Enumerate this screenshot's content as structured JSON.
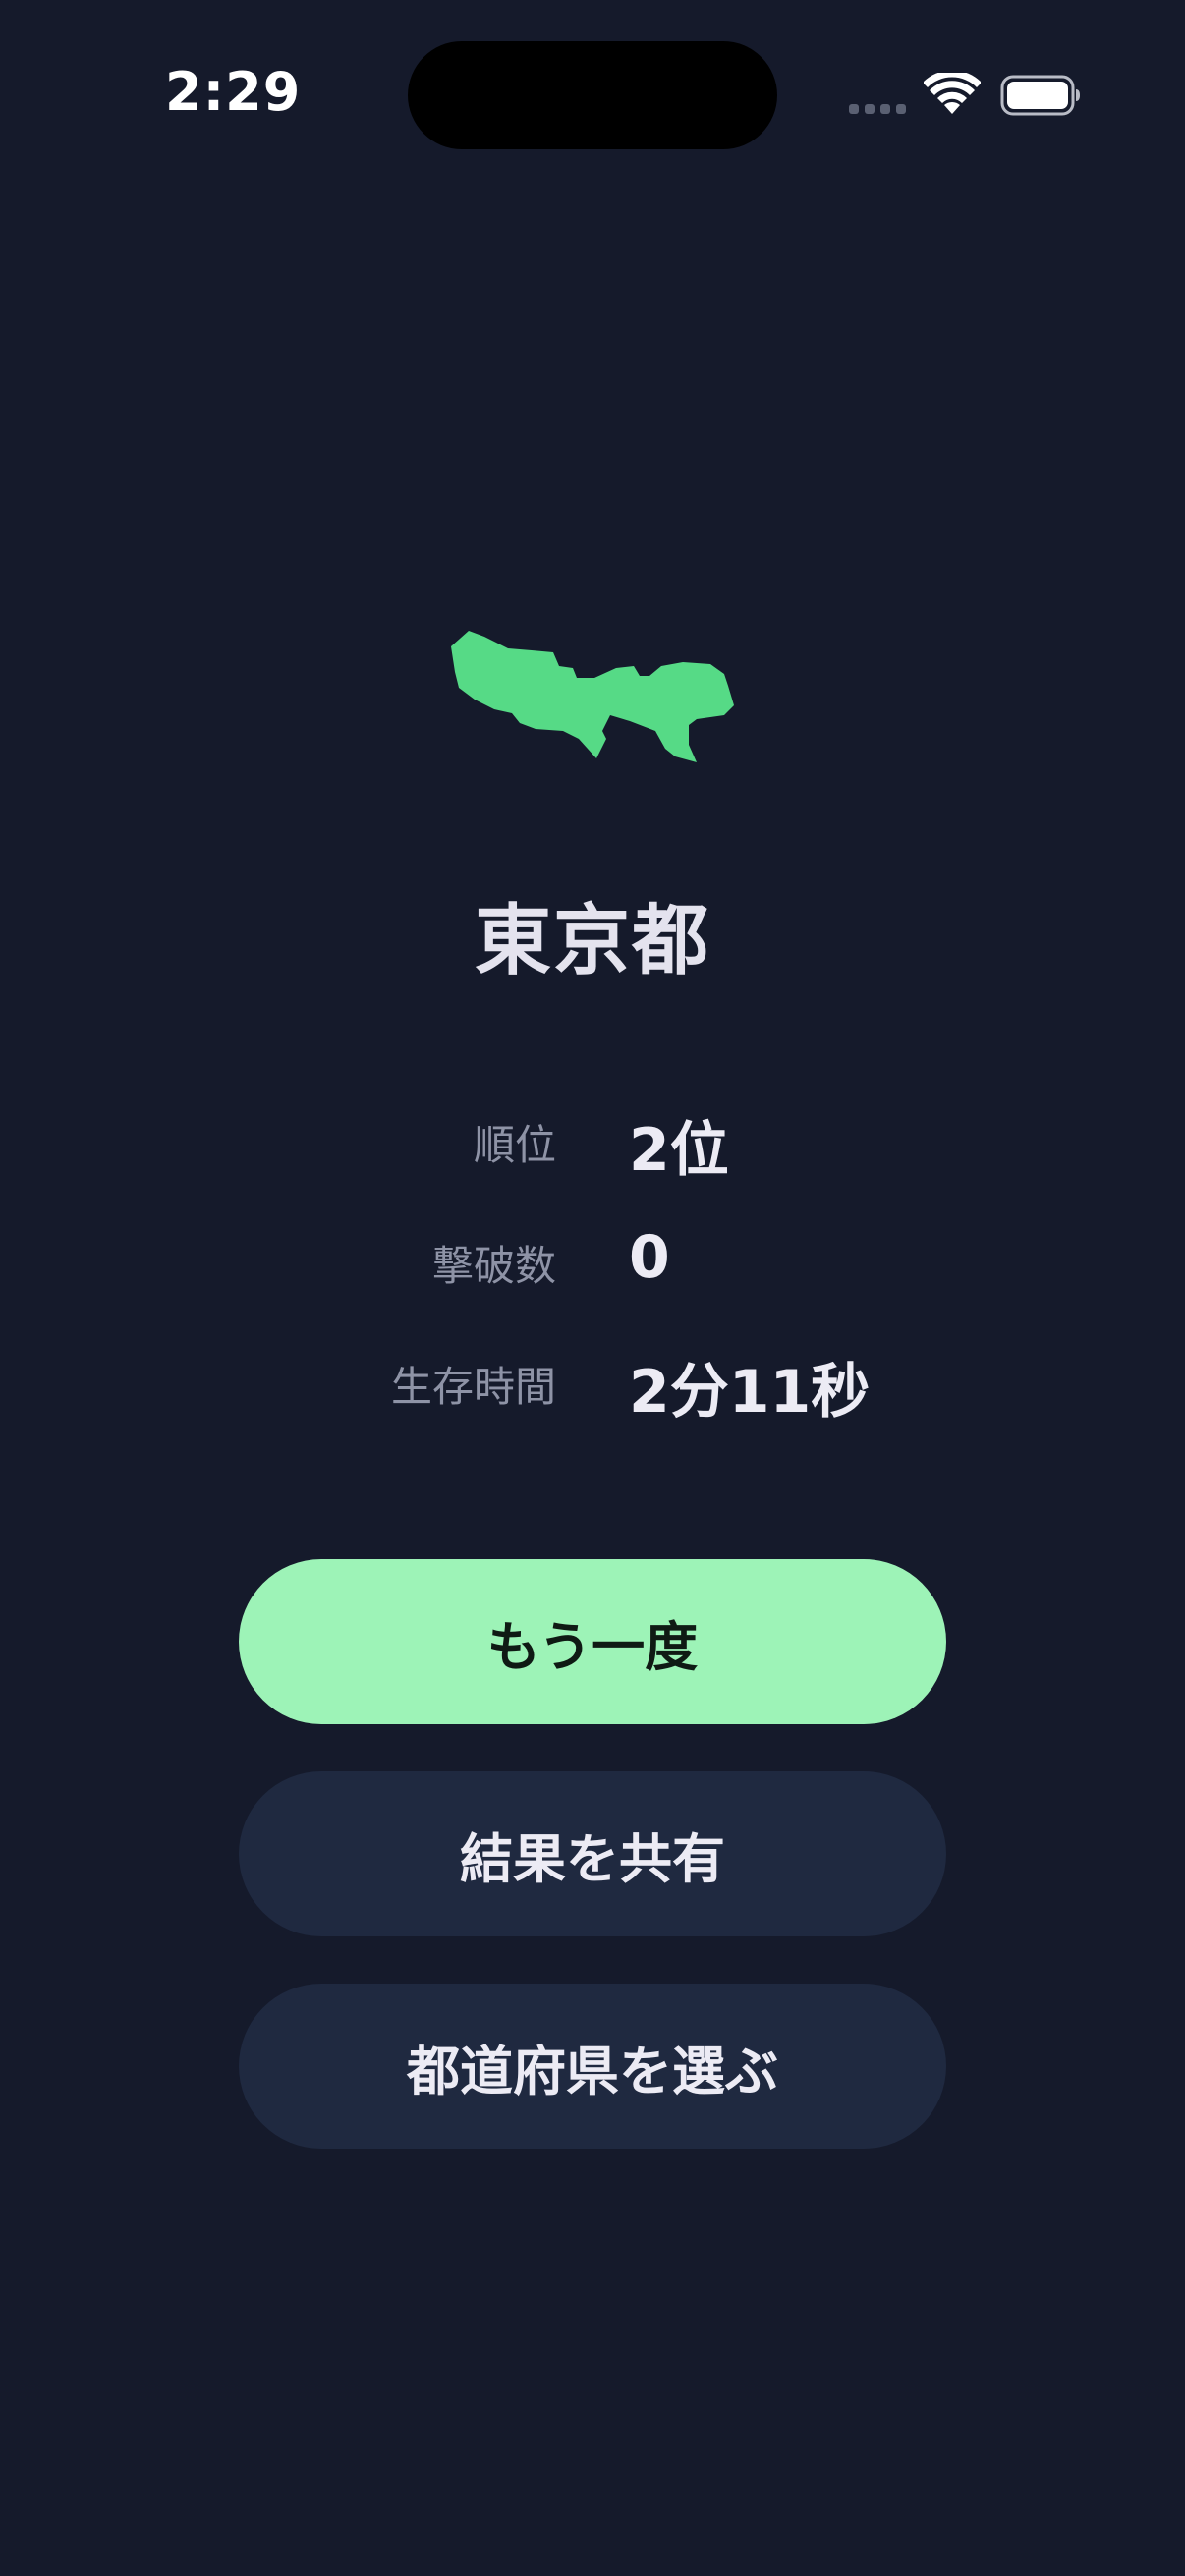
{
  "status_bar": {
    "time": "2:29"
  },
  "result": {
    "prefecture": "東京都",
    "map_icon": "tokyo-map-silhouette",
    "accent_color": "#56da86"
  },
  "stats": [
    {
      "label": "順位",
      "value": "2位"
    },
    {
      "label": "撃破数",
      "value": "0"
    },
    {
      "label": "生存時間",
      "value": "2分11秒"
    }
  ],
  "actions": {
    "retry_label": "もう一度",
    "share_label": "結果を共有",
    "select_label": "都道府県を選ぶ"
  },
  "colors": {
    "background": "#151a2b",
    "primary_button": "#9df3b7",
    "secondary_button": "#1f2940"
  }
}
